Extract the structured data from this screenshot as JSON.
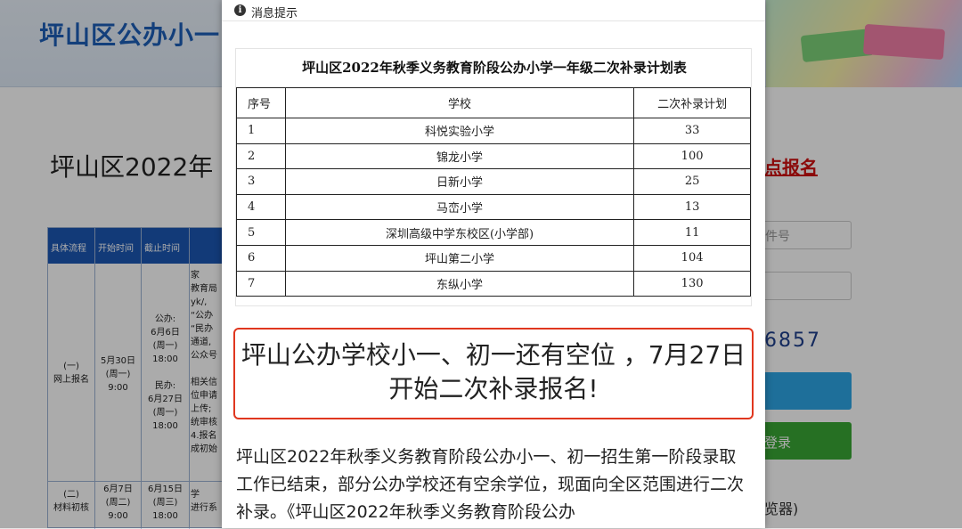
{
  "background": {
    "logo_text": "坪山区公办小一",
    "page_title": "坪山区2022年",
    "register_link": "点报名",
    "input_placeholder": "件号",
    "captcha": "6857",
    "login_button": "登录",
    "browser_note": "览器)",
    "table": {
      "headers": [
        "具体流程",
        "开始时间",
        "截止时间"
      ],
      "row1": {
        "step": "(一)\n网上报名",
        "start": "5月30日\n(周一)\n9:00",
        "end": "公办:\n6月6日\n(周一)\n18:00\n\n民办:\n6月27日\n(周一)\n18:00"
      },
      "row2": {
        "step": "(二)\n材料初核",
        "start": "6月7日\n(周二)\n9:00",
        "end": "6月15日\n(周三)\n18:00"
      },
      "col_notes": "家\n教育局\nyk/,\n“公办\n“民办\n通道,\n公众号\n\n相关信\n位申请\n上传;\n统审核\n4.报名\n成初始",
      "col_notes2": "学\n进行系"
    }
  },
  "modal": {
    "title": "消息提示",
    "info_icon": "i",
    "plan_table": {
      "caption": "坪山区2022年秋季义务教育阶段公办小学一年级二次补录计划表",
      "headers": [
        "序号",
        "学校",
        "二次补录计划"
      ],
      "rows": [
        {
          "idx": "1",
          "school": "科悦实验小学",
          "plan": "33"
        },
        {
          "idx": "2",
          "school": "锦龙小学",
          "plan": "100"
        },
        {
          "idx": "3",
          "school": "日新小学",
          "plan": "25"
        },
        {
          "idx": "4",
          "school": "马峦小学",
          "plan": "13"
        },
        {
          "idx": "5",
          "school": "深圳高级中学东校区(小学部)",
          "plan": "11"
        },
        {
          "idx": "6",
          "school": "坪山第二小学",
          "plan": "104"
        },
        {
          "idx": "7",
          "school": "东纵小学",
          "plan": "130"
        }
      ]
    },
    "notice": "坪山公办学校小一、初一还有空位 ，7月27日开始二次补录报名!",
    "body": "坪山区2022年秋季义务教育阶段公办小一、初一招生第一阶段录取工作已结束，部分公办学校还有空余学位，现面向全区范围进行二次补录。《坪山区2022年秋季义务教育阶段公办"
  },
  "colors": {
    "accent": "#1c57b3",
    "notice_border": "#e0371f",
    "login_green": "#3aa835",
    "submit_blue": "#2ea6e6"
  }
}
